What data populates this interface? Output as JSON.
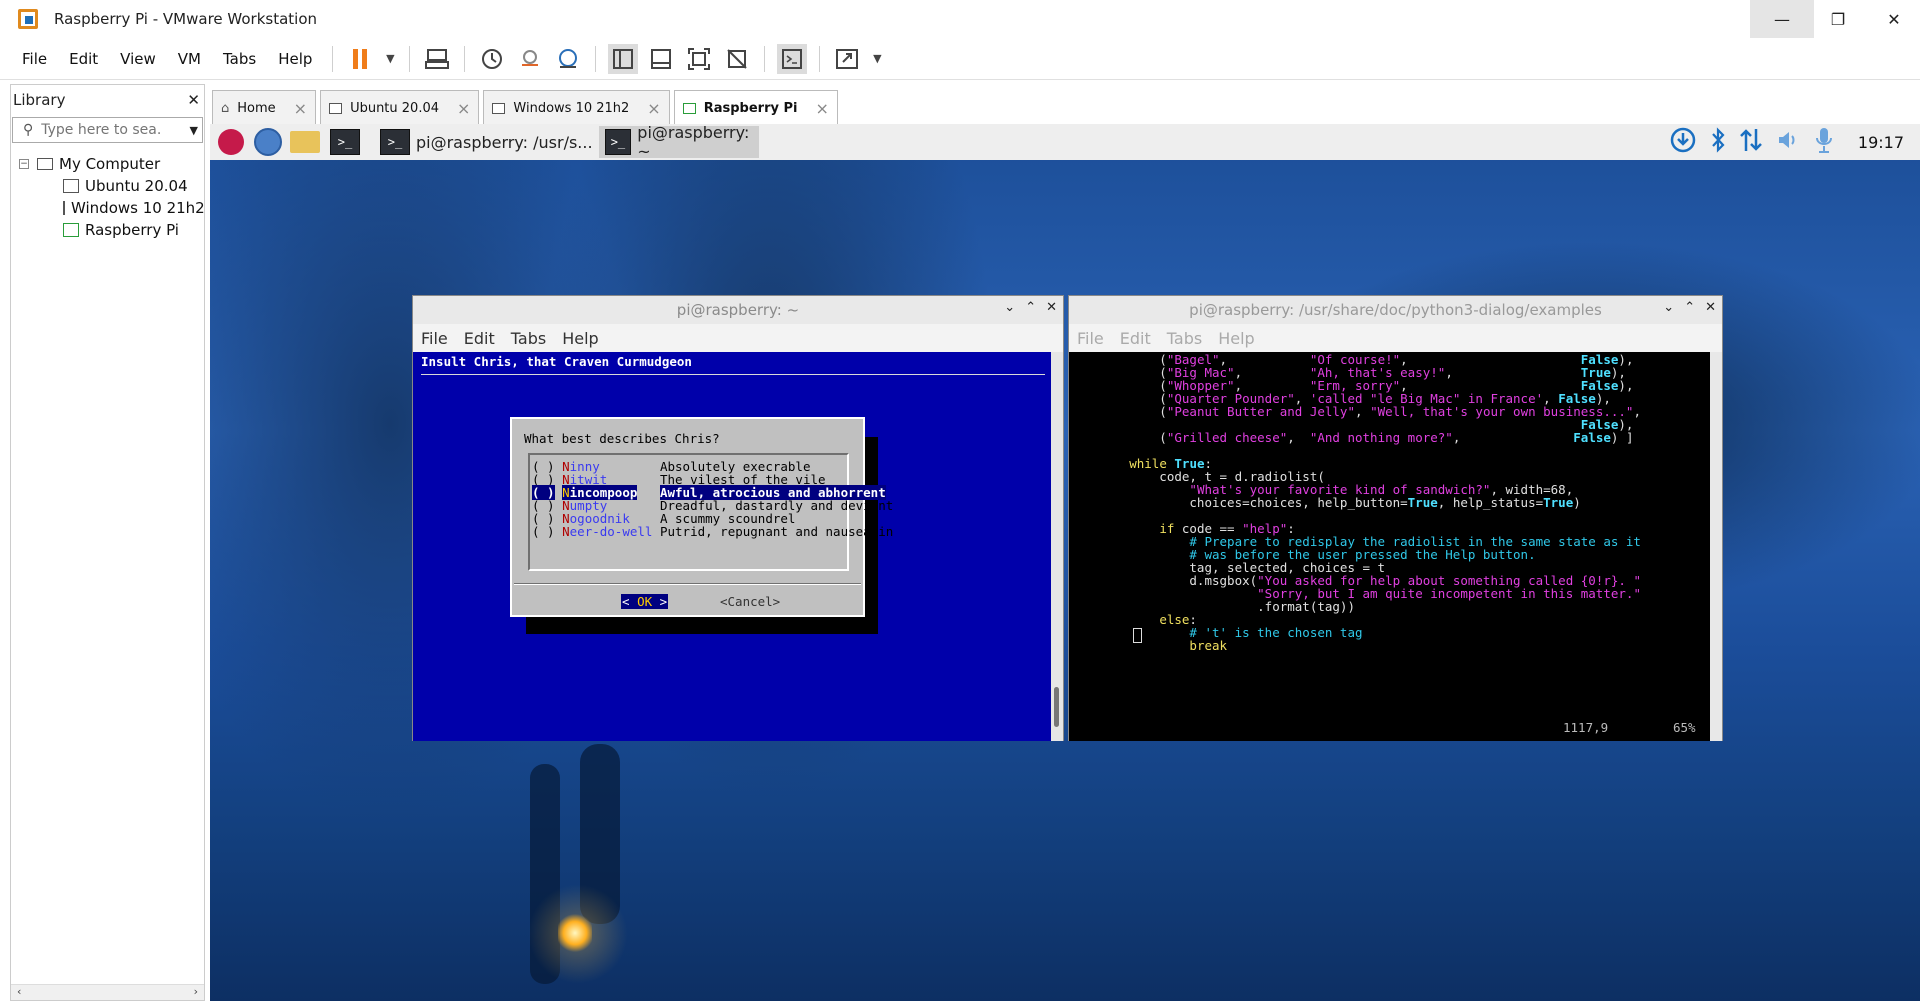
{
  "window": {
    "title": "Raspberry Pi - VMware Workstation"
  },
  "menubar": [
    "File",
    "Edit",
    "View",
    "VM",
    "Tabs",
    "Help"
  ],
  "library": {
    "title": "Library",
    "search_placeholder": "Type here to sea...",
    "root": "My Computer",
    "items": [
      "Ubuntu 20.04",
      "Windows 10 21h2",
      "Raspberry Pi"
    ]
  },
  "tabs": [
    {
      "label": "Home"
    },
    {
      "label": "Ubuntu 20.04"
    },
    {
      "label": "Windows 10 21h2"
    },
    {
      "label": "Raspberry Pi"
    }
  ],
  "guest_taskbar": {
    "windows": [
      "pi@raspberry: /usr/s...",
      "pi@raspberry: ~"
    ],
    "clock": "19:17"
  },
  "term1": {
    "title": "pi@raspberry: ~",
    "menu": [
      "File",
      "Edit",
      "Tabs",
      "Help"
    ],
    "dialog": {
      "heading": "Insult Chris, that Craven Curmudgeon",
      "question": "What best describes Chris?",
      "options": [
        {
          "tag": "Ninny",
          "desc": "Absolutely execrable",
          "selected": false
        },
        {
          "tag": "Nitwit",
          "desc": "The vilest of the vile",
          "selected": false
        },
        {
          "tag": "Nincompoop",
          "desc": "Awful, atrocious and abhorrent",
          "selected": true
        },
        {
          "tag": "Numpty",
          "desc": "Dreadful, dastardly and deviant",
          "selected": false
        },
        {
          "tag": "Nogoodnik",
          "desc": "A scummy scoundrel",
          "selected": false
        },
        {
          "tag": "Neer-do-well",
          "desc": "Putrid, repugnant and nauseatin",
          "selected": false
        }
      ],
      "ok_label": "OK",
      "cancel_label": "<Cancel>"
    }
  },
  "term2": {
    "title": "pi@raspberry: /usr/share/doc/python3-dialog/examples",
    "menu": [
      "File",
      "Edit",
      "Tabs",
      "Help"
    ],
    "code": [
      "            (\"Bagel\",           \"Of course!\",                       False),",
      "            (\"Big Mac\",         \"Ah, that's easy!\",                 True),",
      "            (\"Whopper\",         \"Erm, sorry\",                       False),",
      "            (\"Quarter Pounder\", 'called \"le Big Mac\" in France', False),",
      "            (\"Peanut Butter and Jelly\", \"Well, that's your own business...\",",
      "                                                                    False),",
      "            (\"Grilled cheese\",  \"And nothing more?\",               False) ]",
      "",
      "        while True:",
      "            code, t = d.radiolist(",
      "                \"What's your favorite kind of sandwich?\", width=68,",
      "                choices=choices, help_button=True, help_status=True)",
      "",
      "            if code == \"help\":",
      "                # Prepare to redisplay the radiolist in the same state as it",
      "                # was before the user pressed the Help button.",
      "                tag, selected, choices = t",
      "                d.msgbox(\"You asked for help about something called {0!r}. \"",
      "                         \"Sorry, but I am quite incompetent in this matter.\"",
      "                         .format(tag))",
      "            else:",
      "                # 't' is the chosen tag",
      "                break"
    ],
    "status_position": "1117,9",
    "status_percent": "65%"
  }
}
